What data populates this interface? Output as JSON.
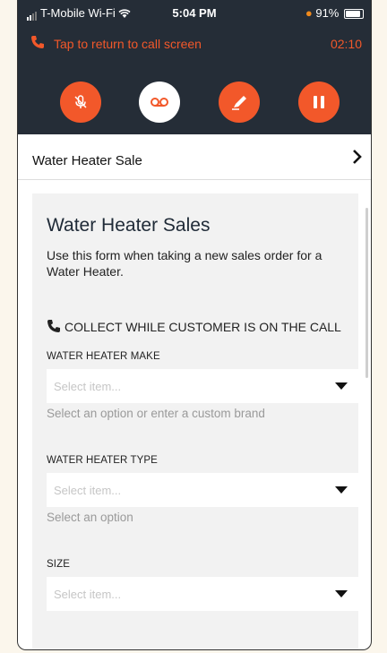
{
  "status_bar": {
    "carrier": "T-Mobile Wi-Fi",
    "time": "5:04 PM",
    "battery": "91%"
  },
  "call_banner": {
    "label": "Tap to return to call screen",
    "timer": "02:10"
  },
  "call_actions": [
    {
      "name": "mute-button",
      "icon": "microphone-off-icon"
    },
    {
      "name": "voicemail-button",
      "icon": "voicemail-icon"
    },
    {
      "name": "notes-button",
      "icon": "pen-icon"
    },
    {
      "name": "hold-button",
      "icon": "pause-icon"
    }
  ],
  "breadcrumb": {
    "title": "Water Heater Sale"
  },
  "form": {
    "title": "Water Heater Sales",
    "description": "Use this form when taking a new sales order for a Water Heater.",
    "collect_note": "COLLECT WHILE CUSTOMER IS ON THE CALL",
    "fields": [
      {
        "label": "WATER HEATER MAKE",
        "placeholder": "Select item...",
        "hint": "Select an option or enter a custom brand"
      },
      {
        "label": "WATER HEATER TYPE",
        "placeholder": "Select item...",
        "hint": "Select an option"
      },
      {
        "label": "SIZE",
        "placeholder": "Select item...",
        "hint": ""
      }
    ]
  },
  "colors": {
    "accent": "#f2582a",
    "header_bg": "#252d37",
    "card_bg": "#f2f2f2"
  }
}
